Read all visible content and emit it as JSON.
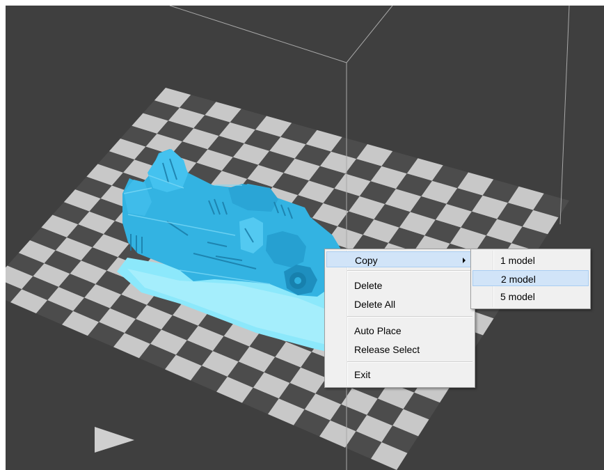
{
  "viewport": {
    "background": "#3f3f3f",
    "plate_colors": {
      "light": "#c8c8c8",
      "dark": "#4c4c4c"
    },
    "model_color": "#36b9e8",
    "model_shadow_color": "#8ce8fb",
    "frame_color": "#a8a8a8"
  },
  "context_menu": {
    "items": [
      {
        "label": "Copy",
        "has_submenu": true,
        "highlighted": true
      },
      {
        "label": "Delete"
      },
      {
        "label": "Delete All"
      },
      {
        "label": "Auto Place"
      },
      {
        "label": "Release Select"
      },
      {
        "label": "Exit"
      }
    ]
  },
  "copy_submenu": {
    "items": [
      {
        "label": "1 model"
      },
      {
        "label": "2 model",
        "highlighted": true
      },
      {
        "label": "5 model"
      }
    ]
  }
}
